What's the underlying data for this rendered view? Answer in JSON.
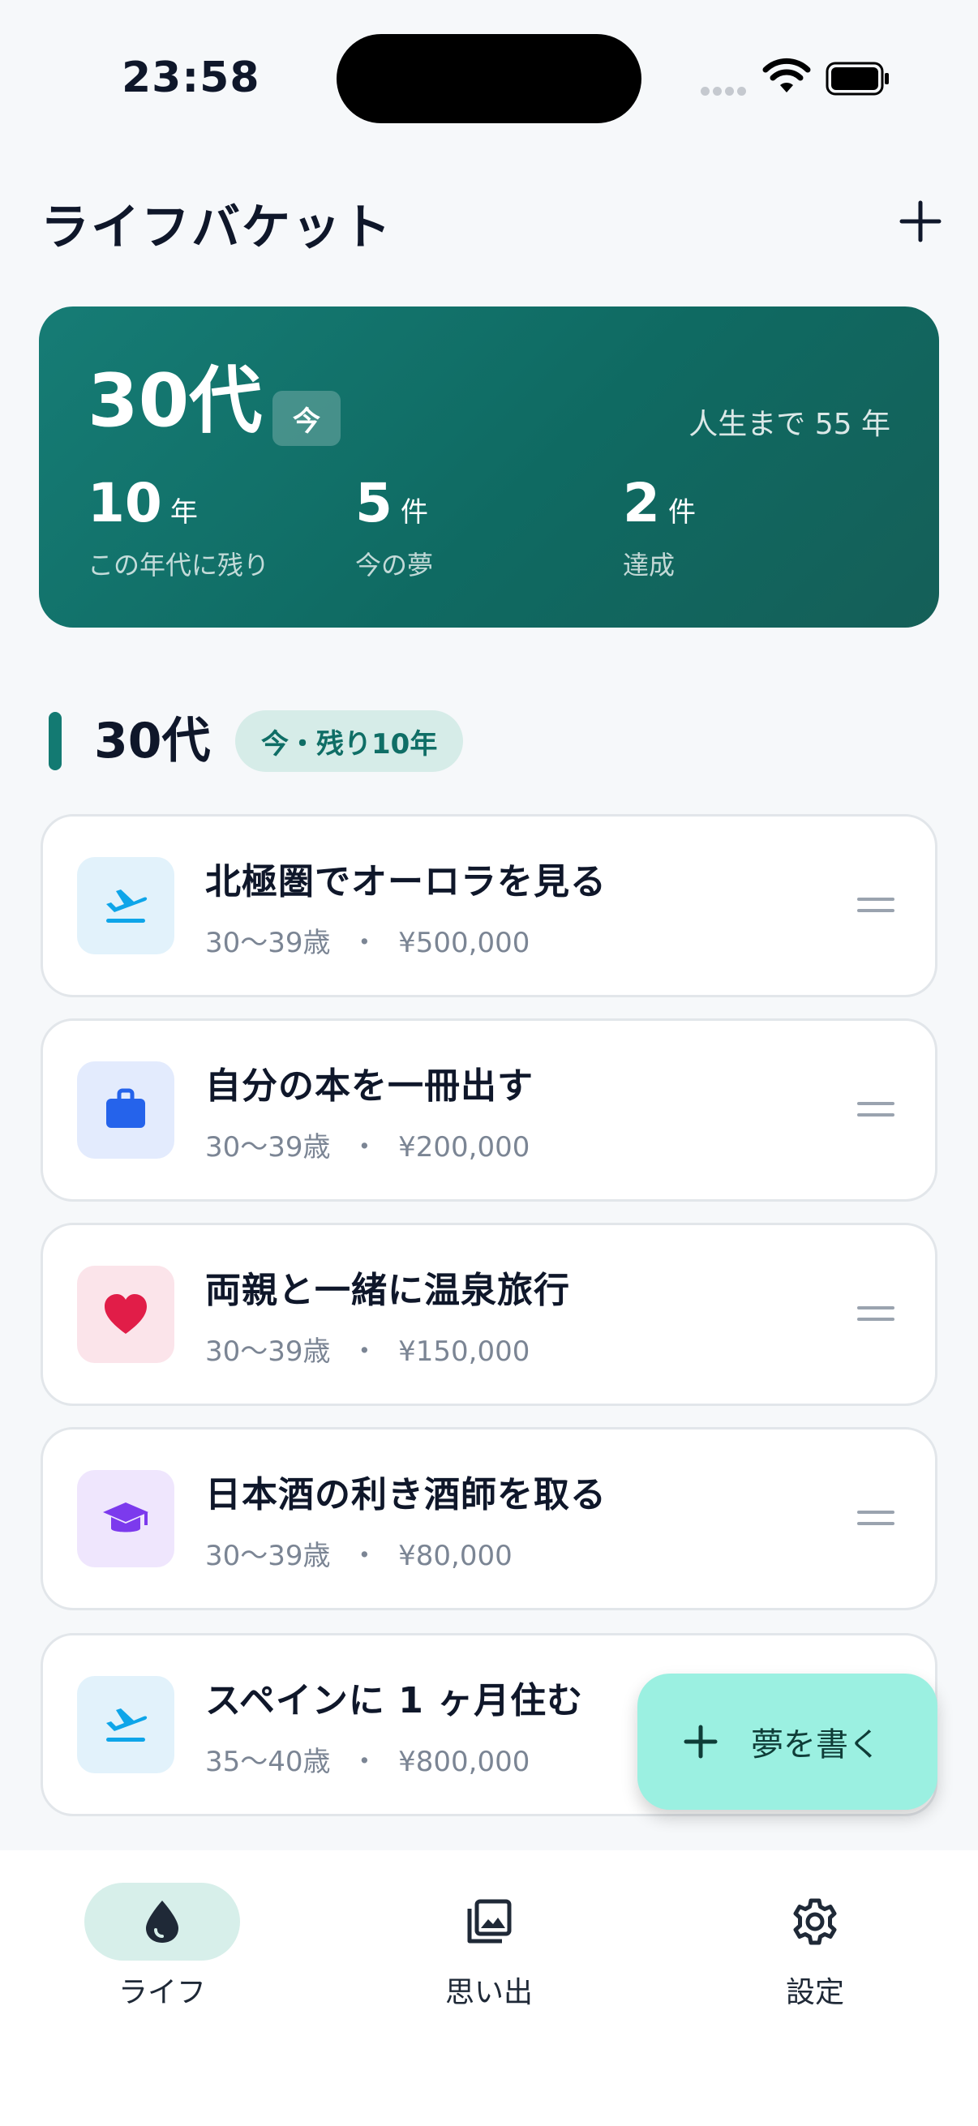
{
  "status_bar": {
    "time": "23:58"
  },
  "header": {
    "title": "ライフバケット",
    "add_icon": "plus-icon"
  },
  "hero": {
    "decade": "30代",
    "now_badge": "今",
    "remaining_life": "人生まで 55 年",
    "stats": [
      {
        "value": "10",
        "unit": "年",
        "label": "この年代に残り"
      },
      {
        "value": "5",
        "unit": "件",
        "label": "今の夢"
      },
      {
        "value": "2",
        "unit": "件",
        "label": "達成"
      }
    ]
  },
  "section": {
    "title": "30代",
    "badge": "今・残り10年"
  },
  "items": [
    {
      "title": "北極圏でオーロラを見る",
      "ages": "30〜39歳",
      "sep": "・",
      "cost": "¥500,000",
      "icon": "airplane-icon",
      "icon_color": "#0ea5e9",
      "icon_bg": "#e2f2fb"
    },
    {
      "title": "自分の本を一冊出す",
      "ages": "30〜39歳",
      "sep": "・",
      "cost": "¥200,000",
      "icon": "briefcase-icon",
      "icon_color": "#2563eb",
      "icon_bg": "#e3ebfd"
    },
    {
      "title": "両親と一緒に温泉旅行",
      "ages": "30〜39歳",
      "sep": "・",
      "cost": "¥150,000",
      "icon": "heart-icon",
      "icon_color": "#e11d48",
      "icon_bg": "#fbe4ea"
    },
    {
      "title": "日本酒の利き酒師を取る",
      "ages": "30〜39歳",
      "sep": "・",
      "cost": "¥80,000",
      "icon": "graduation-cap-icon",
      "icon_color": "#7c3aed",
      "icon_bg": "#efe6fd"
    },
    {
      "title": "スペインに 1 ヶ月住む",
      "ages": "35〜40歳",
      "sep": "・",
      "cost": "¥800,000",
      "icon": "airplane-icon",
      "icon_color": "#0ea5e9",
      "icon_bg": "#e2f2fb"
    }
  ],
  "fab": {
    "label": "夢を書く",
    "icon": "plus-icon"
  },
  "bottom_nav": [
    {
      "label": "ライフ",
      "icon": "drop-icon",
      "active": true
    },
    {
      "label": "思い出",
      "icon": "photo-library-icon",
      "active": false
    },
    {
      "label": "設定",
      "icon": "gear-icon",
      "active": false
    }
  ],
  "colors": {
    "accent": "#137a72",
    "hero_start": "#167c75",
    "hero_end": "#155f58",
    "fab": "#9bf0e1"
  }
}
